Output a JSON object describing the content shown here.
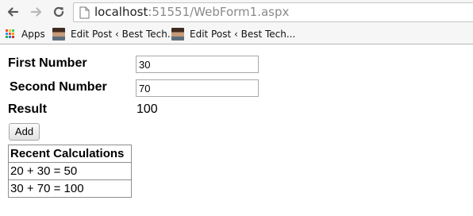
{
  "browser": {
    "url_host": "localhost",
    "url_rest": ":51551/WebForm1.aspx",
    "icons": [
      "back-arrow-icon",
      "forward-arrow-icon",
      "reload-icon",
      "page-icon"
    ]
  },
  "bookmarks": {
    "apps_label": "Apps",
    "items": [
      {
        "label": "Edit Post ‹ Best Tech..."
      },
      {
        "label": "Edit Post ‹ Best Tech..."
      }
    ]
  },
  "form": {
    "first_label": "First Number",
    "first_value": "30",
    "second_label": "Second Number",
    "second_value": "70",
    "result_label": "Result",
    "result_value": "100",
    "add_label": "Add"
  },
  "recent": {
    "header": "Recent Calculations",
    "rows": [
      "20 + 30 = 50",
      "30 + 70 = 100"
    ]
  },
  "colors": {
    "chrome_background": "#f6f6f6",
    "apps_grid": [
      "#e74c3c",
      "#f1c40f",
      "#2ecc71",
      "#3498db",
      "#e74c3c",
      "#f39c12",
      "#27ae60",
      "#2980b9",
      "#c0392b"
    ]
  }
}
